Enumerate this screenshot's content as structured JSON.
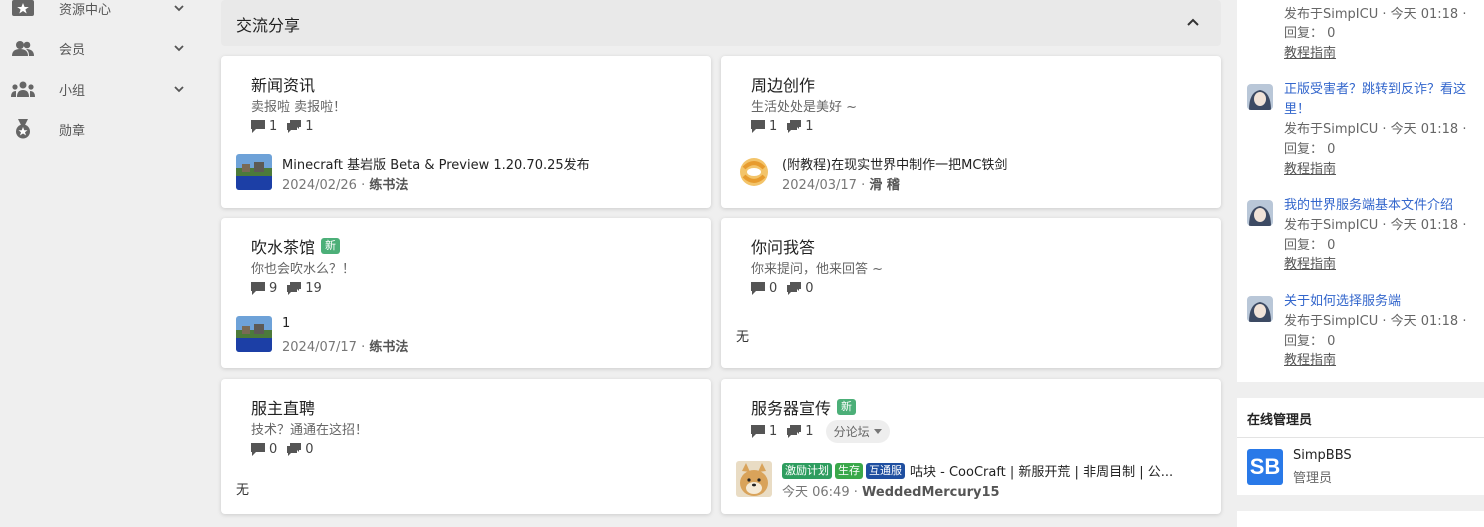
{
  "sidebar": {
    "items": [
      {
        "label": "资源中心",
        "icon": "star-folder-icon"
      },
      {
        "label": "会员",
        "icon": "users-icon"
      },
      {
        "label": "小组",
        "icon": "group-icon"
      },
      {
        "label": "勋章",
        "icon": "medal-icon"
      }
    ]
  },
  "section": {
    "title": "交流分享"
  },
  "forums": [
    {
      "title": "新闻资讯",
      "desc": "卖报啦 卖报啦！",
      "threads": "1",
      "posts": "1",
      "last": {
        "title": "Minecraft 基岩版 Beta & Preview 1.20.70.25发布",
        "date": "2024/02/26",
        "user": "练书法"
      }
    },
    {
      "title": "周边创作",
      "desc": "生活处处是美好 ~",
      "threads": "1",
      "posts": "1",
      "last": {
        "title": "(附教程)在现实世界中制作一把MC铁剑",
        "date": "2024/03/17",
        "user": "滑 稽"
      }
    },
    {
      "title": "吹水茶馆",
      "badge": "新",
      "desc": "你也会吹水么？！",
      "threads": "9",
      "posts": "19",
      "last": {
        "title": "1",
        "date": "2024/07/17",
        "user": "练书法"
      }
    },
    {
      "title": "你问我答",
      "desc": "你来提问，他来回答 ~",
      "threads": "0",
      "posts": "0",
      "none": "无"
    },
    {
      "title": "服主直聘",
      "desc": "技术？通通在这招！",
      "threads": "0",
      "posts": "0",
      "none": "无"
    },
    {
      "title": "服务器宣传",
      "badge": "新",
      "desc": "",
      "threads": "1",
      "posts": "1",
      "subforum": "分论坛",
      "last": {
        "tags": [
          "激励计划",
          "生存",
          "互通服"
        ],
        "title": "咕块 - CooCraft | 新服开荒 | 非周目制 | 公...",
        "date": "今天 06:49",
        "user": "WeddedMercury15"
      }
    }
  ],
  "right_posts": [
    {
      "title": "",
      "meta": "发布于SimpICU · 今天 01:18 ·",
      "reply": "回复：  0",
      "category": "教程指南"
    },
    {
      "title": "正版受害者？跳转到反诈？看这里！",
      "meta": "发布于SimpICU · 今天 01:18 ·",
      "reply": "回复：  0",
      "category": "教程指南"
    },
    {
      "title": "我的世界服务端基本文件介绍",
      "meta": "发布于SimpICU · 今天 01:18 ·",
      "reply": "回复：  0",
      "category": "教程指南"
    },
    {
      "title": "关于如何选择服务端",
      "meta": "发布于SimpICU · 今天 01:18 ·",
      "reply": "回复：  0",
      "category": "教程指南"
    }
  ],
  "admins": {
    "heading": "在线管理员",
    "list": [
      {
        "logo": "SB",
        "name": "SimpBBS",
        "role": "管理员"
      }
    ]
  },
  "colors": {
    "accent": "#3366cc",
    "badge_new": "#4caf78",
    "tag_incentive": "#2e9d5f",
    "tag_survival": "#3aa84a",
    "tag_crossplay": "#1f4fa0",
    "admin_logo": "#2979e8"
  }
}
